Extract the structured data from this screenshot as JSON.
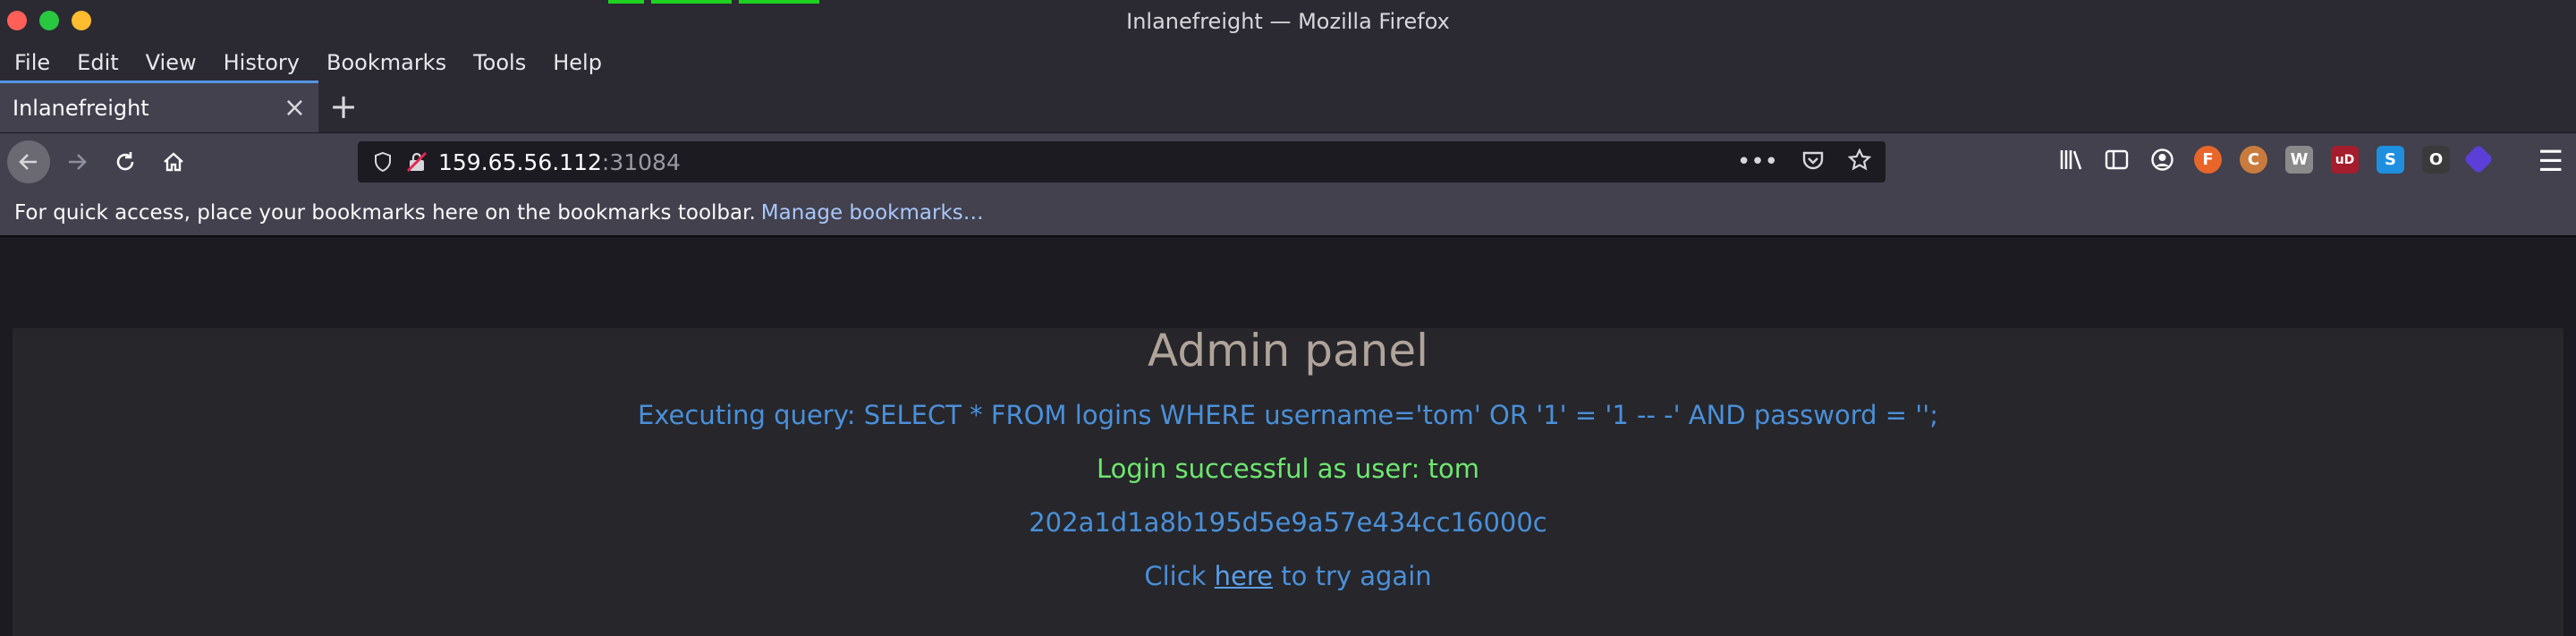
{
  "window": {
    "title": "Inlanefreight — Mozilla Firefox"
  },
  "menu": [
    "File",
    "Edit",
    "View",
    "History",
    "Bookmarks",
    "Tools",
    "Help"
  ],
  "tab": {
    "label": "Inlanefreight",
    "close": "×",
    "new": "+"
  },
  "urlbar": {
    "host": "159.65.56.112",
    "port": ":31084"
  },
  "bookmarks_bar": {
    "message": "For quick access, place your bookmarks here on the bookmarks toolbar.",
    "manage_label": "Manage bookmarks…"
  },
  "page": {
    "title": "Admin panel",
    "query_text": "Executing query: SELECT * FROM logins WHERE username='tom' OR '1' = '1 -- -' AND password = '';",
    "success_text": "Login successful as user: tom",
    "hash": "202a1d1a8b195d5e9a57e434cc16000c",
    "retry_prefix": "Click",
    "retry_link": "here",
    "retry_suffix": "to try again"
  },
  "colors": {
    "query": "#4a90d9",
    "success": "#6ee86e",
    "title": "#b0a49a"
  }
}
